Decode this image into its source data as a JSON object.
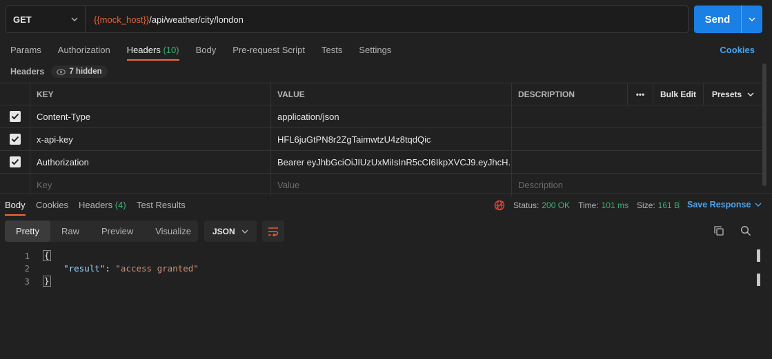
{
  "request": {
    "method": "GET",
    "url_var": "{{mock_host}}",
    "url_path": "/api/weather/city/london",
    "send_label": "Send"
  },
  "req_tabs": [
    {
      "label": "Params"
    },
    {
      "label": "Authorization"
    },
    {
      "label": "Headers",
      "count": "(10)"
    },
    {
      "label": "Body"
    },
    {
      "label": "Pre-request Script"
    },
    {
      "label": "Tests"
    },
    {
      "label": "Settings"
    }
  ],
  "cookies_label": "Cookies",
  "headers_section": {
    "label": "Headers",
    "hidden_label": "7 hidden"
  },
  "table": {
    "columns": {
      "key": "KEY",
      "value": "VALUE",
      "description": "DESCRIPTION",
      "more": "•••",
      "bulk_edit": "Bulk Edit",
      "presets": "Presets"
    },
    "rows": [
      {
        "key": "Content-Type",
        "value": "application/json",
        "description": ""
      },
      {
        "key": "x-api-key",
        "value": "HFL6juGtPN8r2ZgTaimwtzU4z8tqdQic",
        "description": ""
      },
      {
        "key": "Authorization",
        "value": "Bearer eyJhbGciOiJIUzUxMiIsInR5cCI6IkpXVCJ9.eyJhcH...",
        "description": ""
      }
    ],
    "placeholders": {
      "key": "Key",
      "value": "Value",
      "description": "Description"
    }
  },
  "response": {
    "tabs": [
      {
        "label": "Body"
      },
      {
        "label": "Cookies"
      },
      {
        "label": "Headers",
        "count": "(4)"
      },
      {
        "label": "Test Results"
      }
    ],
    "status_label": "Status:",
    "status_value": "200 OK",
    "time_label": "Time:",
    "time_value": "101 ms",
    "size_label": "Size:",
    "size_value": "161 B",
    "save_label": "Save Response"
  },
  "format": {
    "modes": [
      "Pretty",
      "Raw",
      "Preview",
      "Visualize"
    ],
    "active": "Pretty",
    "language": "JSON"
  },
  "code_lines": {
    "n1": "1",
    "n2": "2",
    "n3": "3",
    "open": "{",
    "key": "\"result\"",
    "colon": ": ",
    "value": "\"access granted\"",
    "close": "}"
  },
  "colors": {
    "accent": "#f26b3a",
    "send": "#1a80e5",
    "success": "#3cb371",
    "link": "#4aa3ee"
  }
}
